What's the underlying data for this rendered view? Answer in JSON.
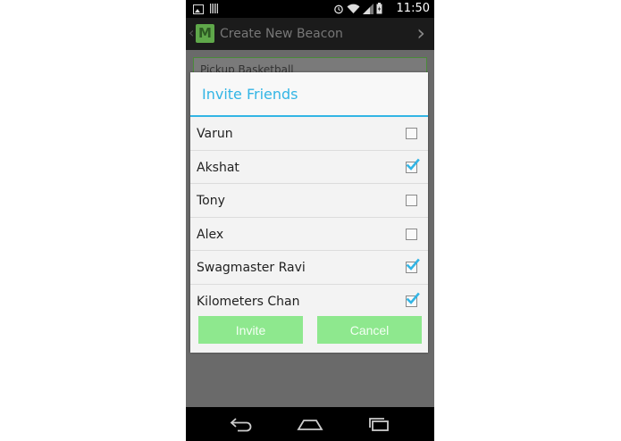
{
  "status_bar": {
    "time": "11:50"
  },
  "action_bar": {
    "title": "Create New Beacon",
    "logo_letter": "M"
  },
  "background": {
    "field_text": "Pickup Basketball"
  },
  "dialog": {
    "title": "Invite Friends",
    "friends": [
      {
        "name": "Varun",
        "checked": false
      },
      {
        "name": "Akshat",
        "checked": true
      },
      {
        "name": "Tony",
        "checked": false
      },
      {
        "name": "Alex",
        "checked": false
      },
      {
        "name": "Swagmaster Ravi",
        "checked": true
      },
      {
        "name": "Kilometers Chan",
        "checked": true
      }
    ],
    "invite_label": "Invite",
    "cancel_label": "Cancel"
  },
  "colors": {
    "accent": "#33b5e5",
    "button": "#8ee88e",
    "check": "#33b5e5"
  }
}
